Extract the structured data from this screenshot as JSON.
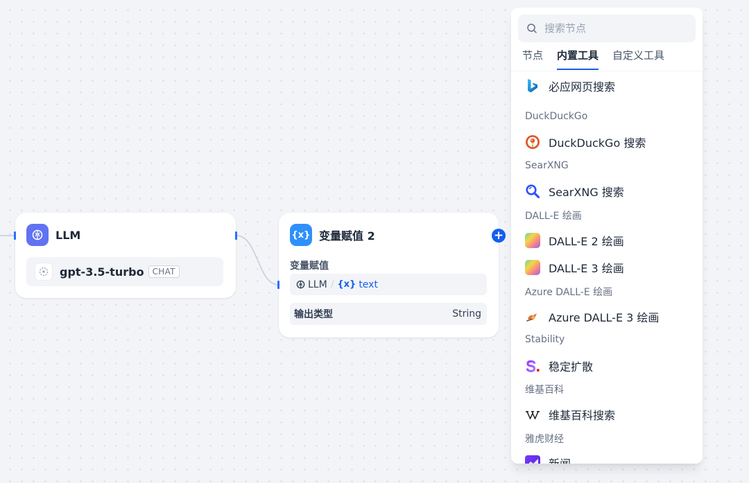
{
  "llm_node": {
    "title": "LLM",
    "model_name": "gpt-3.5-turbo",
    "model_mode": "CHAT"
  },
  "assign_node": {
    "title": "变量赋值 2",
    "section_label": "变量赋值",
    "variable": {
      "source_node": "LLM",
      "separator": "/",
      "symbol": "{x}",
      "name": "text"
    },
    "output_key": "输出类型",
    "output_value": "String",
    "add_symbol": "+"
  },
  "panel": {
    "search_placeholder": "搜索节点",
    "tabs": [
      "节点",
      "内置工具",
      "自定义工具"
    ],
    "active_tab": "内置工具",
    "groups": [
      {
        "label": "",
        "tools": [
          {
            "name": "必应网页搜索",
            "icon": "bing-icon"
          }
        ]
      },
      {
        "label": "DuckDuckGo",
        "tools": [
          {
            "name": "DuckDuckGo 搜索",
            "icon": "duckduckgo-icon"
          }
        ]
      },
      {
        "label": "SearXNG",
        "tools": [
          {
            "name": "SearXNG 搜索",
            "icon": "searxng-icon"
          }
        ]
      },
      {
        "label": "DALL-E 绘画",
        "tools": [
          {
            "name": "DALL-E 2 绘画",
            "icon": "dalle-icon"
          },
          {
            "name": "DALL-E 3 绘画",
            "icon": "dalle-icon"
          }
        ]
      },
      {
        "label": "Azure DALL-E 绘画",
        "tools": [
          {
            "name": "Azure DALL-E 3 绘画",
            "icon": "azure-dalle-icon"
          }
        ]
      },
      {
        "label": "Stability",
        "tools": [
          {
            "name": "稳定扩散",
            "icon": "stability-icon"
          }
        ]
      },
      {
        "label": "维基百科",
        "tools": [
          {
            "name": "维基百科搜索",
            "icon": "wikipedia-icon"
          }
        ]
      },
      {
        "label": "雅虎财经",
        "tools": [
          {
            "name": "新闻",
            "icon": "yahoo-finance-icon"
          }
        ]
      }
    ]
  },
  "colors": {
    "canvas_bg": "#f2f4f7",
    "accent": "#155eef",
    "llm_icon_bg": "#6172f3",
    "assign_icon_bg": "#2e90fa",
    "edge": "#d0d5dd"
  }
}
